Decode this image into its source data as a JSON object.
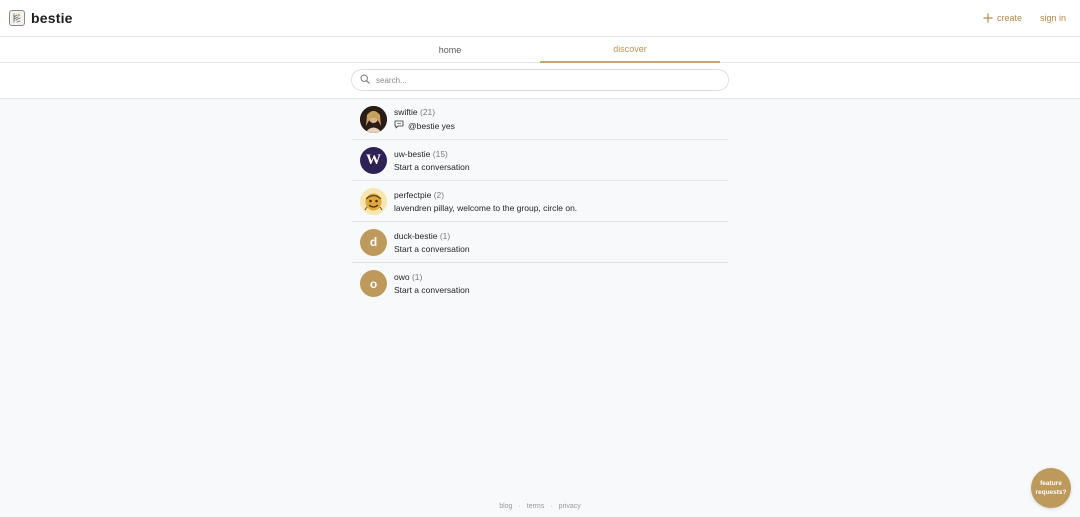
{
  "brand": {
    "name": "bestie",
    "logo_icon": "bestie-logo-icon"
  },
  "header": {
    "create_label": "create",
    "signin_label": "sign in",
    "accent_color": "#b38a4d"
  },
  "tabs": [
    {
      "label": "home",
      "active": false
    },
    {
      "label": "discover",
      "active": true
    }
  ],
  "search": {
    "placeholder": "search...",
    "value": ""
  },
  "groups": [
    {
      "name": "swiftie",
      "count": "(21)",
      "subtitle": "@bestie yes",
      "has_comment_icon": true,
      "avatar": "photo-avatar"
    },
    {
      "name": "uw-bestie",
      "count": "(15)",
      "subtitle": "Start a conversation",
      "has_comment_icon": false,
      "avatar": "W",
      "avatar_color": "#2e2254"
    },
    {
      "name": "perfectpie",
      "count": "(2)",
      "subtitle": "lavendren pillay, welcome to the group, circle on.",
      "has_comment_icon": false,
      "avatar": "illustration-avatar"
    },
    {
      "name": "duck-bestie",
      "count": "(1)",
      "subtitle": "Start a conversation",
      "has_comment_icon": false,
      "avatar": "d",
      "avatar_color": "#bd9a5c"
    },
    {
      "name": "owo",
      "count": "(1)",
      "subtitle": "Start a conversation",
      "has_comment_icon": false,
      "avatar": "o",
      "avatar_color": "#bd9a5c"
    }
  ],
  "footer": {
    "blog": "blog",
    "terms": "terms",
    "privacy": "privacy",
    "separator": "·"
  },
  "feature_button": {
    "line1": "feature",
    "line2": "requests?"
  }
}
